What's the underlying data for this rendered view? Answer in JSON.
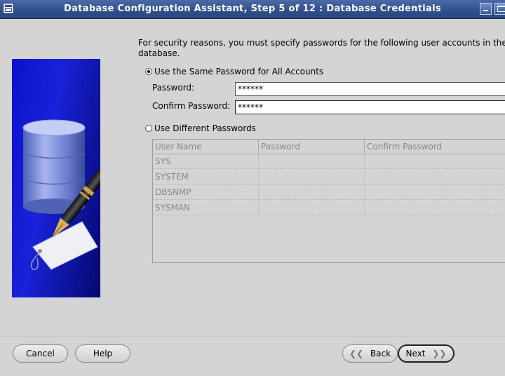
{
  "window": {
    "title": "Database Configuration Assistant, Step 5 of 12 : Database Credentials"
  },
  "intro_text": {
    "line1": "For security reasons, you must specify passwords for the following user accounts in the new",
    "line2": "database."
  },
  "same_password": {
    "label": "Use the Same Password for All Accounts",
    "selected": true,
    "password_label": "Password:",
    "password_value": "******",
    "confirm_label": "Confirm Password:",
    "confirm_value": "******"
  },
  "different_passwords": {
    "label": "Use Different Passwords",
    "selected": false
  },
  "accounts_table": {
    "headers": [
      "User Name",
      "Password",
      "Confirm Password"
    ],
    "rows": [
      [
        "SYS",
        "",
        ""
      ],
      [
        "SYSTEM",
        "",
        ""
      ],
      [
        "DBSNMP",
        "",
        ""
      ],
      [
        "SYSMAN",
        "",
        ""
      ]
    ]
  },
  "buttons": {
    "cancel": "Cancel",
    "help": "Help",
    "back": "Back",
    "next": "Next"
  },
  "icons": {
    "app": "database-window-icon",
    "illustration": "database-pen-tag-illustration"
  }
}
